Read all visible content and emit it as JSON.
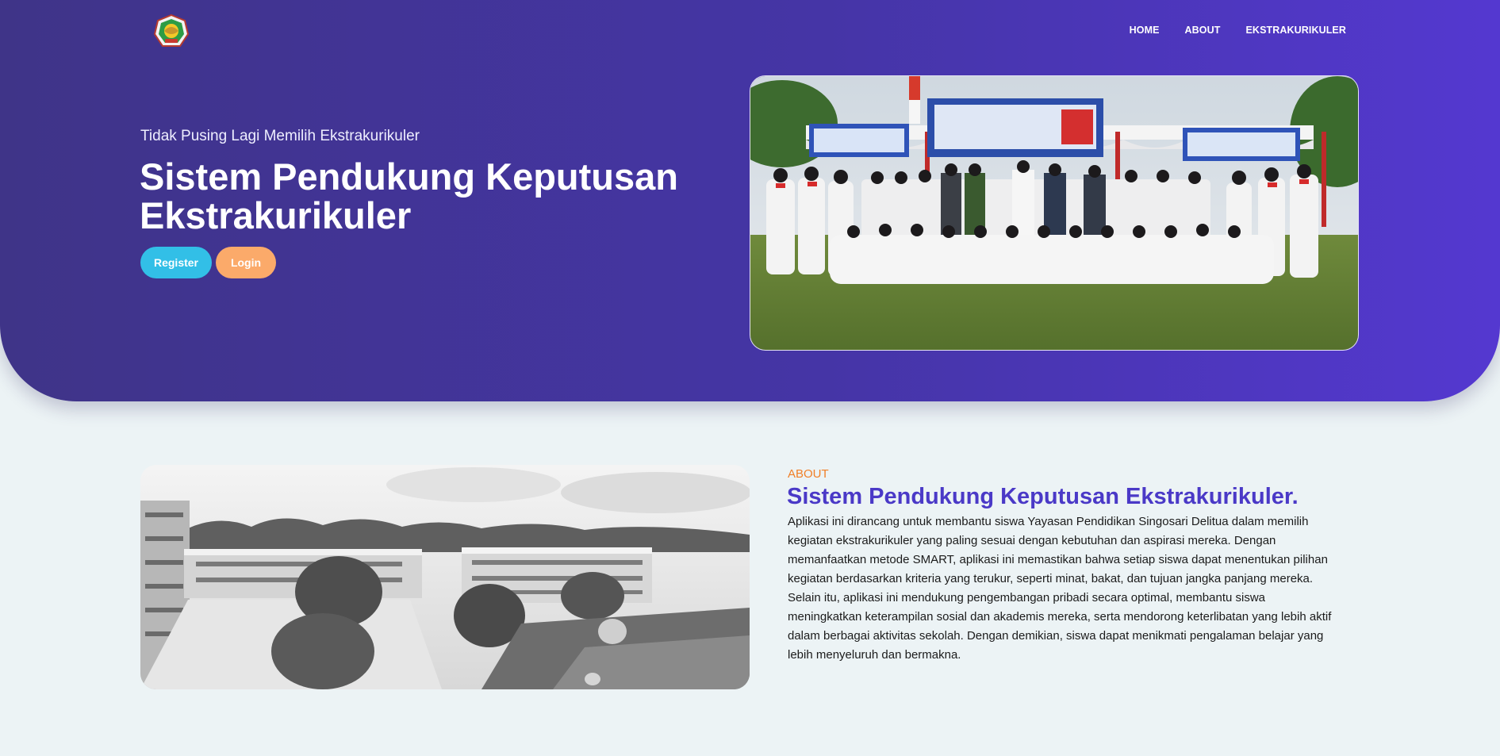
{
  "nav": {
    "home": "HOME",
    "about": "ABOUT",
    "ekstrakurikuler": "EKSTRAKURIKULER"
  },
  "hero": {
    "subtitle": "Tidak Pusing Lagi Memilih Ekstrakurikuler",
    "title": "Sistem Pendukung Keputusan Ekstrakurikuler",
    "register_label": "Register",
    "login_label": "Login"
  },
  "about": {
    "label": "ABOUT",
    "title": "Sistem Pendukung Keputusan Ekstrakurikuler.",
    "text": "Aplikasi ini dirancang untuk membantu siswa Yayasan Pendidikan Singosari Delitua dalam memilih kegiatan ekstrakurikuler yang paling sesuai dengan kebutuhan dan aspirasi mereka. Dengan memanfaatkan metode SMART, aplikasi ini memastikan bahwa setiap siswa dapat menentukan pilihan kegiatan berdasarkan kriteria yang terukur, seperti minat, bakat, dan tujuan jangka panjang mereka. Selain itu, aplikasi ini mendukung pengembangan pribadi secara optimal, membantu siswa meningkatkan keterampilan sosial dan akademis mereka, serta mendorong keterlibatan yang lebih aktif dalam berbagai aktivitas sekolah. Dengan demikian, siswa dapat menikmati pengalaman belajar yang lebih menyeluruh dan bermakna."
  },
  "colors": {
    "hero_gradient_start": "#3f3488",
    "hero_gradient_end": "#5438d0",
    "register_button": "#32bfe7",
    "login_button": "#fbaa6a",
    "about_label": "#f07f27",
    "about_title": "#4a39c7",
    "page_background": "#ecf3f5"
  },
  "icons": {
    "logo": "school-emblem-icon"
  }
}
